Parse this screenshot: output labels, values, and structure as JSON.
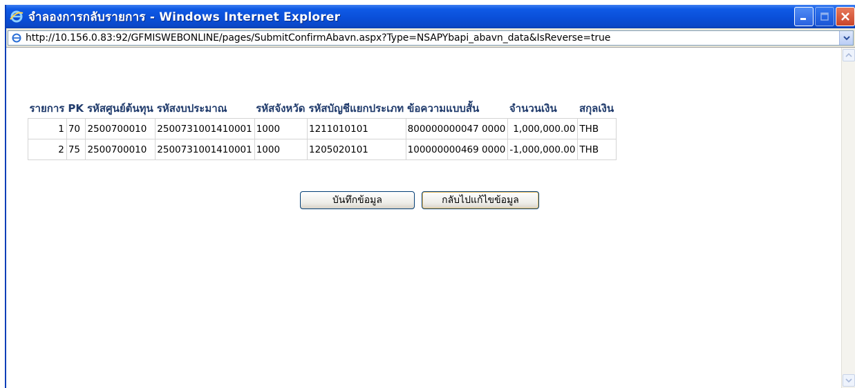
{
  "window": {
    "title": "จำลองการกลับรายการ - Windows Internet Explorer",
    "icons": [
      "ie-logo-icon",
      "minimize-icon",
      "maximize-icon",
      "close-icon"
    ]
  },
  "address_bar": {
    "url": "http://10.156.0.83:92/GFMISWEBONLINE/pages/SubmitConfirmAbavn.aspx?Type=NSAPYbapi_abavn_data&IsReverse=true"
  },
  "table": {
    "headers": [
      "รายการ",
      "PK",
      "รหัสศูนย์ต้นทุน",
      "รหัสงบประมาณ",
      "รหัสจังหวัด",
      "รหัสบัญชีแยกประเภท",
      "ข้อความแบบสั้น",
      "จำนวนเงิน",
      "สกุลเงิน"
    ],
    "rows": [
      [
        "1",
        "70",
        "2500700010",
        "2500731001410001",
        "1000",
        "1211010101",
        "800000000047 0000",
        "1,000,000.00",
        "THB"
      ],
      [
        "2",
        "75",
        "2500700010",
        "2500731001410001",
        "1000",
        "1205020101",
        "100000000469 0000",
        "-1,000,000.00",
        "THB"
      ]
    ]
  },
  "buttons": {
    "save_label": "บันทึกข้อมูล",
    "back_label": "กลับไปแก้ไขข้อมูล"
  },
  "colors": {
    "titlebar": "#0a4fd9",
    "header_text": "#1f3a6b",
    "close_button": "#c8452a"
  }
}
